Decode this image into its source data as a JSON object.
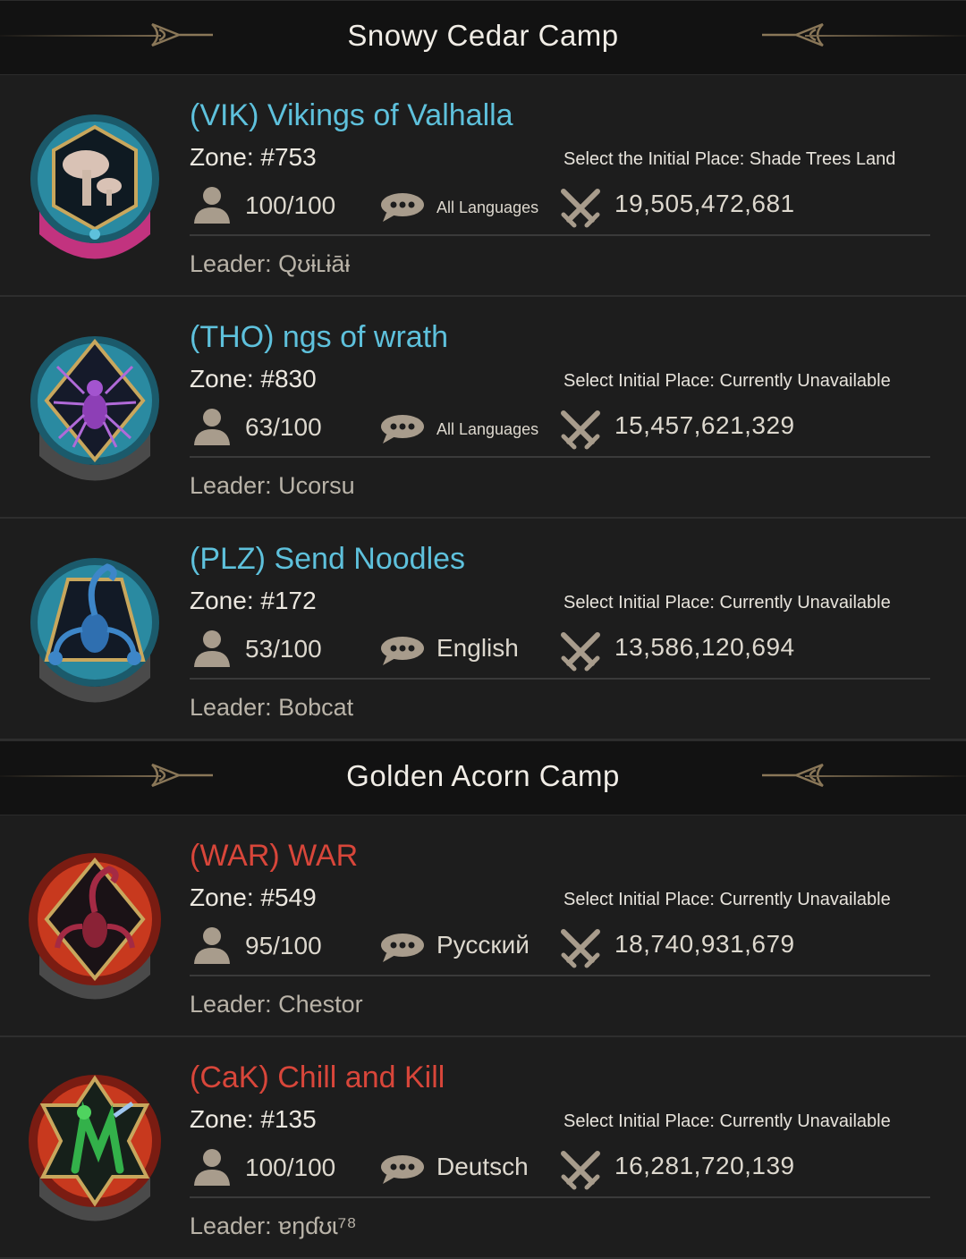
{
  "camps": [
    {
      "title": "Snowy Cedar Camp",
      "alliances": [
        {
          "name": "(VIK) Vikings of Valhalla",
          "color": "blue",
          "zone": "Zone: #753",
          "initial": "Select the Initial Place: Shade Trees Land",
          "members": "100/100",
          "language": "All Languages",
          "power": "19,505,472,681",
          "leader": "Leader: Qʊɨʟɨāɨ",
          "emblem": "mushroom-emblem"
        },
        {
          "name": "(THO) ngs of wrath",
          "color": "blue",
          "zone": "Zone: #830",
          "initial": "Select Initial Place: Currently Unavailable",
          "members": "63/100",
          "language": "All Languages",
          "power": "15,457,621,329",
          "leader": "Leader: Ucorsu",
          "emblem": "spider-emblem"
        },
        {
          "name": "(PLZ) Send Noodles",
          "color": "blue",
          "zone": "Zone: #172",
          "initial": "Select Initial Place: Currently Unavailable",
          "members": "53/100",
          "language": "English",
          "power": "13,586,120,694",
          "leader": "Leader: Bobcat",
          "emblem": "scorpion-emblem"
        }
      ]
    },
    {
      "title": "Golden Acorn Camp",
      "alliances": [
        {
          "name": "(WAR) WAR",
          "color": "red",
          "zone": "Zone: #549",
          "initial": "Select Initial Place: Currently Unavailable",
          "members": "95/100",
          "language": "Русский",
          "power": "18,740,931,679",
          "leader": "Leader: Chestor",
          "emblem": "scorpion-emblem-red"
        },
        {
          "name": "(CaK) Chill and Kill",
          "color": "red",
          "zone": "Zone: #135",
          "initial": "Select Initial Place: Currently Unavailable",
          "members": "100/100",
          "language": "Deutsch",
          "power": "16,281,720,139",
          "leader": "Leader: ɐŋɗʊɩ⁷⁸",
          "emblem": "mantis-emblem"
        }
      ]
    }
  ]
}
